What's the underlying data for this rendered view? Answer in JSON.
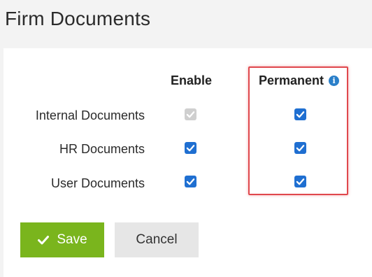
{
  "page": {
    "title": "Firm Documents"
  },
  "columns": {
    "enable": "Enable",
    "permanent": "Permanent",
    "info_icon": "info-icon"
  },
  "rows": [
    {
      "label": "Internal Documents",
      "enable": true,
      "enable_disabled": true,
      "permanent": true
    },
    {
      "label": "HR Documents",
      "enable": true,
      "enable_disabled": false,
      "permanent": true
    },
    {
      "label": "User Documents",
      "enable": true,
      "enable_disabled": false,
      "permanent": true
    }
  ],
  "buttons": {
    "save": "Save",
    "cancel": "Cancel"
  },
  "colors": {
    "checkbox": "#1f6fd1",
    "checkbox_disabled": "#cfcfcf",
    "save_button": "#7ab51d",
    "highlight": "#e0484d",
    "info": "#2a7fc9"
  }
}
